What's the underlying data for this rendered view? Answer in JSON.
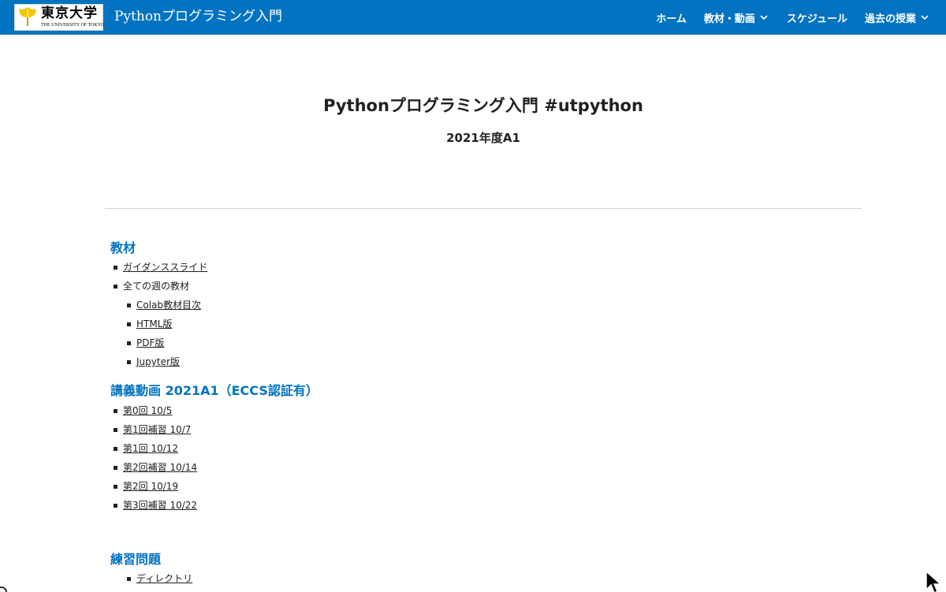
{
  "header": {
    "logo": {
      "name_ja": "東京大学",
      "name_en": "THE UNIVERSITY OF TOKYO"
    },
    "site_title": "Pythonプログラミング入門",
    "nav": [
      {
        "label": "ホーム",
        "has_dropdown": false
      },
      {
        "label": "教材・動画",
        "has_dropdown": true
      },
      {
        "label": "スケジュール",
        "has_dropdown": false
      },
      {
        "label": "過去の授業",
        "has_dropdown": true
      }
    ]
  },
  "hero": {
    "title": "Pythonプログラミング入門 #utpython",
    "subtitle": "2021年度A1"
  },
  "sections": {
    "materials": {
      "heading": "教材",
      "items": [
        {
          "label": "ガイダンススライド",
          "link": true
        },
        {
          "label": "全ての週の教材",
          "link": false
        }
      ],
      "subitems": [
        {
          "label": "Colab教材目次"
        },
        {
          "label": "HTML版"
        },
        {
          "label": "PDF版"
        },
        {
          "label": "Jupyter版"
        }
      ]
    },
    "videos": {
      "heading": "講義動画 2021A1（ECCS認証有）",
      "items": [
        {
          "label": "第0回 10/5"
        },
        {
          "label": "第1回補習 10/7"
        },
        {
          "label": "第1回 10/12"
        },
        {
          "label": "第2回補習 10/14"
        },
        {
          "label": "第2回 10/19"
        },
        {
          "label": "第3回補習 10/22"
        }
      ]
    },
    "exercises": {
      "heading": "練習問題",
      "items": [
        {
          "label": "ディレクトリ"
        }
      ]
    }
  },
  "colors": {
    "brand_blue": "#0273c0",
    "text": "#212121",
    "divider": "#d5d5d5"
  },
  "icons": [
    "ginkgo-logo-icon",
    "chevron-down-icon",
    "mouse-pointer-icon"
  ]
}
